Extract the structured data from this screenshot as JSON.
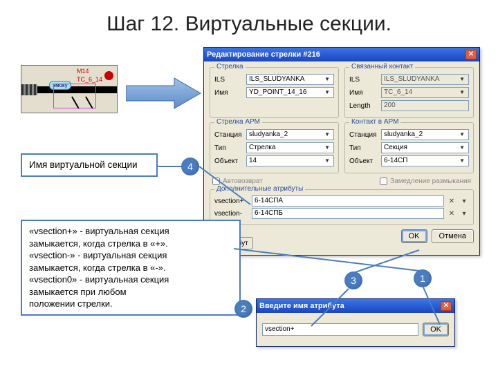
{
  "title": "Шаг 12. Виртуальные секции.",
  "schematic": {
    "cap": "эмоку",
    "label_top": "М14",
    "label_mid": "ТС_6_14"
  },
  "dialog": {
    "title": "Редактирование стрелки #216",
    "group_switch": "Стрелка",
    "group_contact": "Связанный контакт",
    "group_switch_arm": "Стрелка АРМ",
    "group_contact_arm": "Контакт в АРМ",
    "labels": {
      "ils": "ILS",
      "name": "Имя",
      "length": "Length",
      "station": "Станция",
      "type": "Тип",
      "object": "Объект"
    },
    "switch": {
      "ils": "ILS_SLUDYANKA",
      "name": "YD_POINT_14_16"
    },
    "contact": {
      "ils": "ILS_SLUDYANKA",
      "name": "TC_6_14",
      "length": "200"
    },
    "switch_arm": {
      "station": "sludyanka_2",
      "type": "Стрелка",
      "object": "14"
    },
    "contact_arm": {
      "station": "sludyanka_2",
      "type": "Секция",
      "object": "6-14СП"
    },
    "chk_auto": "Автовозврат",
    "chk_slow": "Замедление размыкания",
    "group_extra": "Дополнительные атрибуты",
    "vsection_plus_label": "vsection+",
    "vsection_minus_label": "vsection-",
    "vsection_plus_val": "6-14СПА",
    "vsection_minus_val": "6-14СПБ",
    "btn_add": "+ атрибут",
    "btn_ok": "OK",
    "btn_cancel": "Отмена"
  },
  "small_dialog": {
    "title": "Введите имя атрибута",
    "value": "vsection+",
    "btn_ok": "OK"
  },
  "callouts": {
    "c1": "Имя виртуальной секции",
    "c2_l1": "«vsection+» - виртуальная секция",
    "c2_l2": "замыкается, когда стрелка в «+».",
    "c2_l3": "«vsection-» - виртуальная секция",
    "c2_l4": "замыкается, когда стрелка в «-».",
    "c2_l5": "«vsection0» - виртуальная секция",
    "c2_l6": "замыкается при любом",
    "c2_l7": "положении стрелки."
  },
  "nums": {
    "n1": "1",
    "n2": "2",
    "n3": "3",
    "n4": "4"
  }
}
